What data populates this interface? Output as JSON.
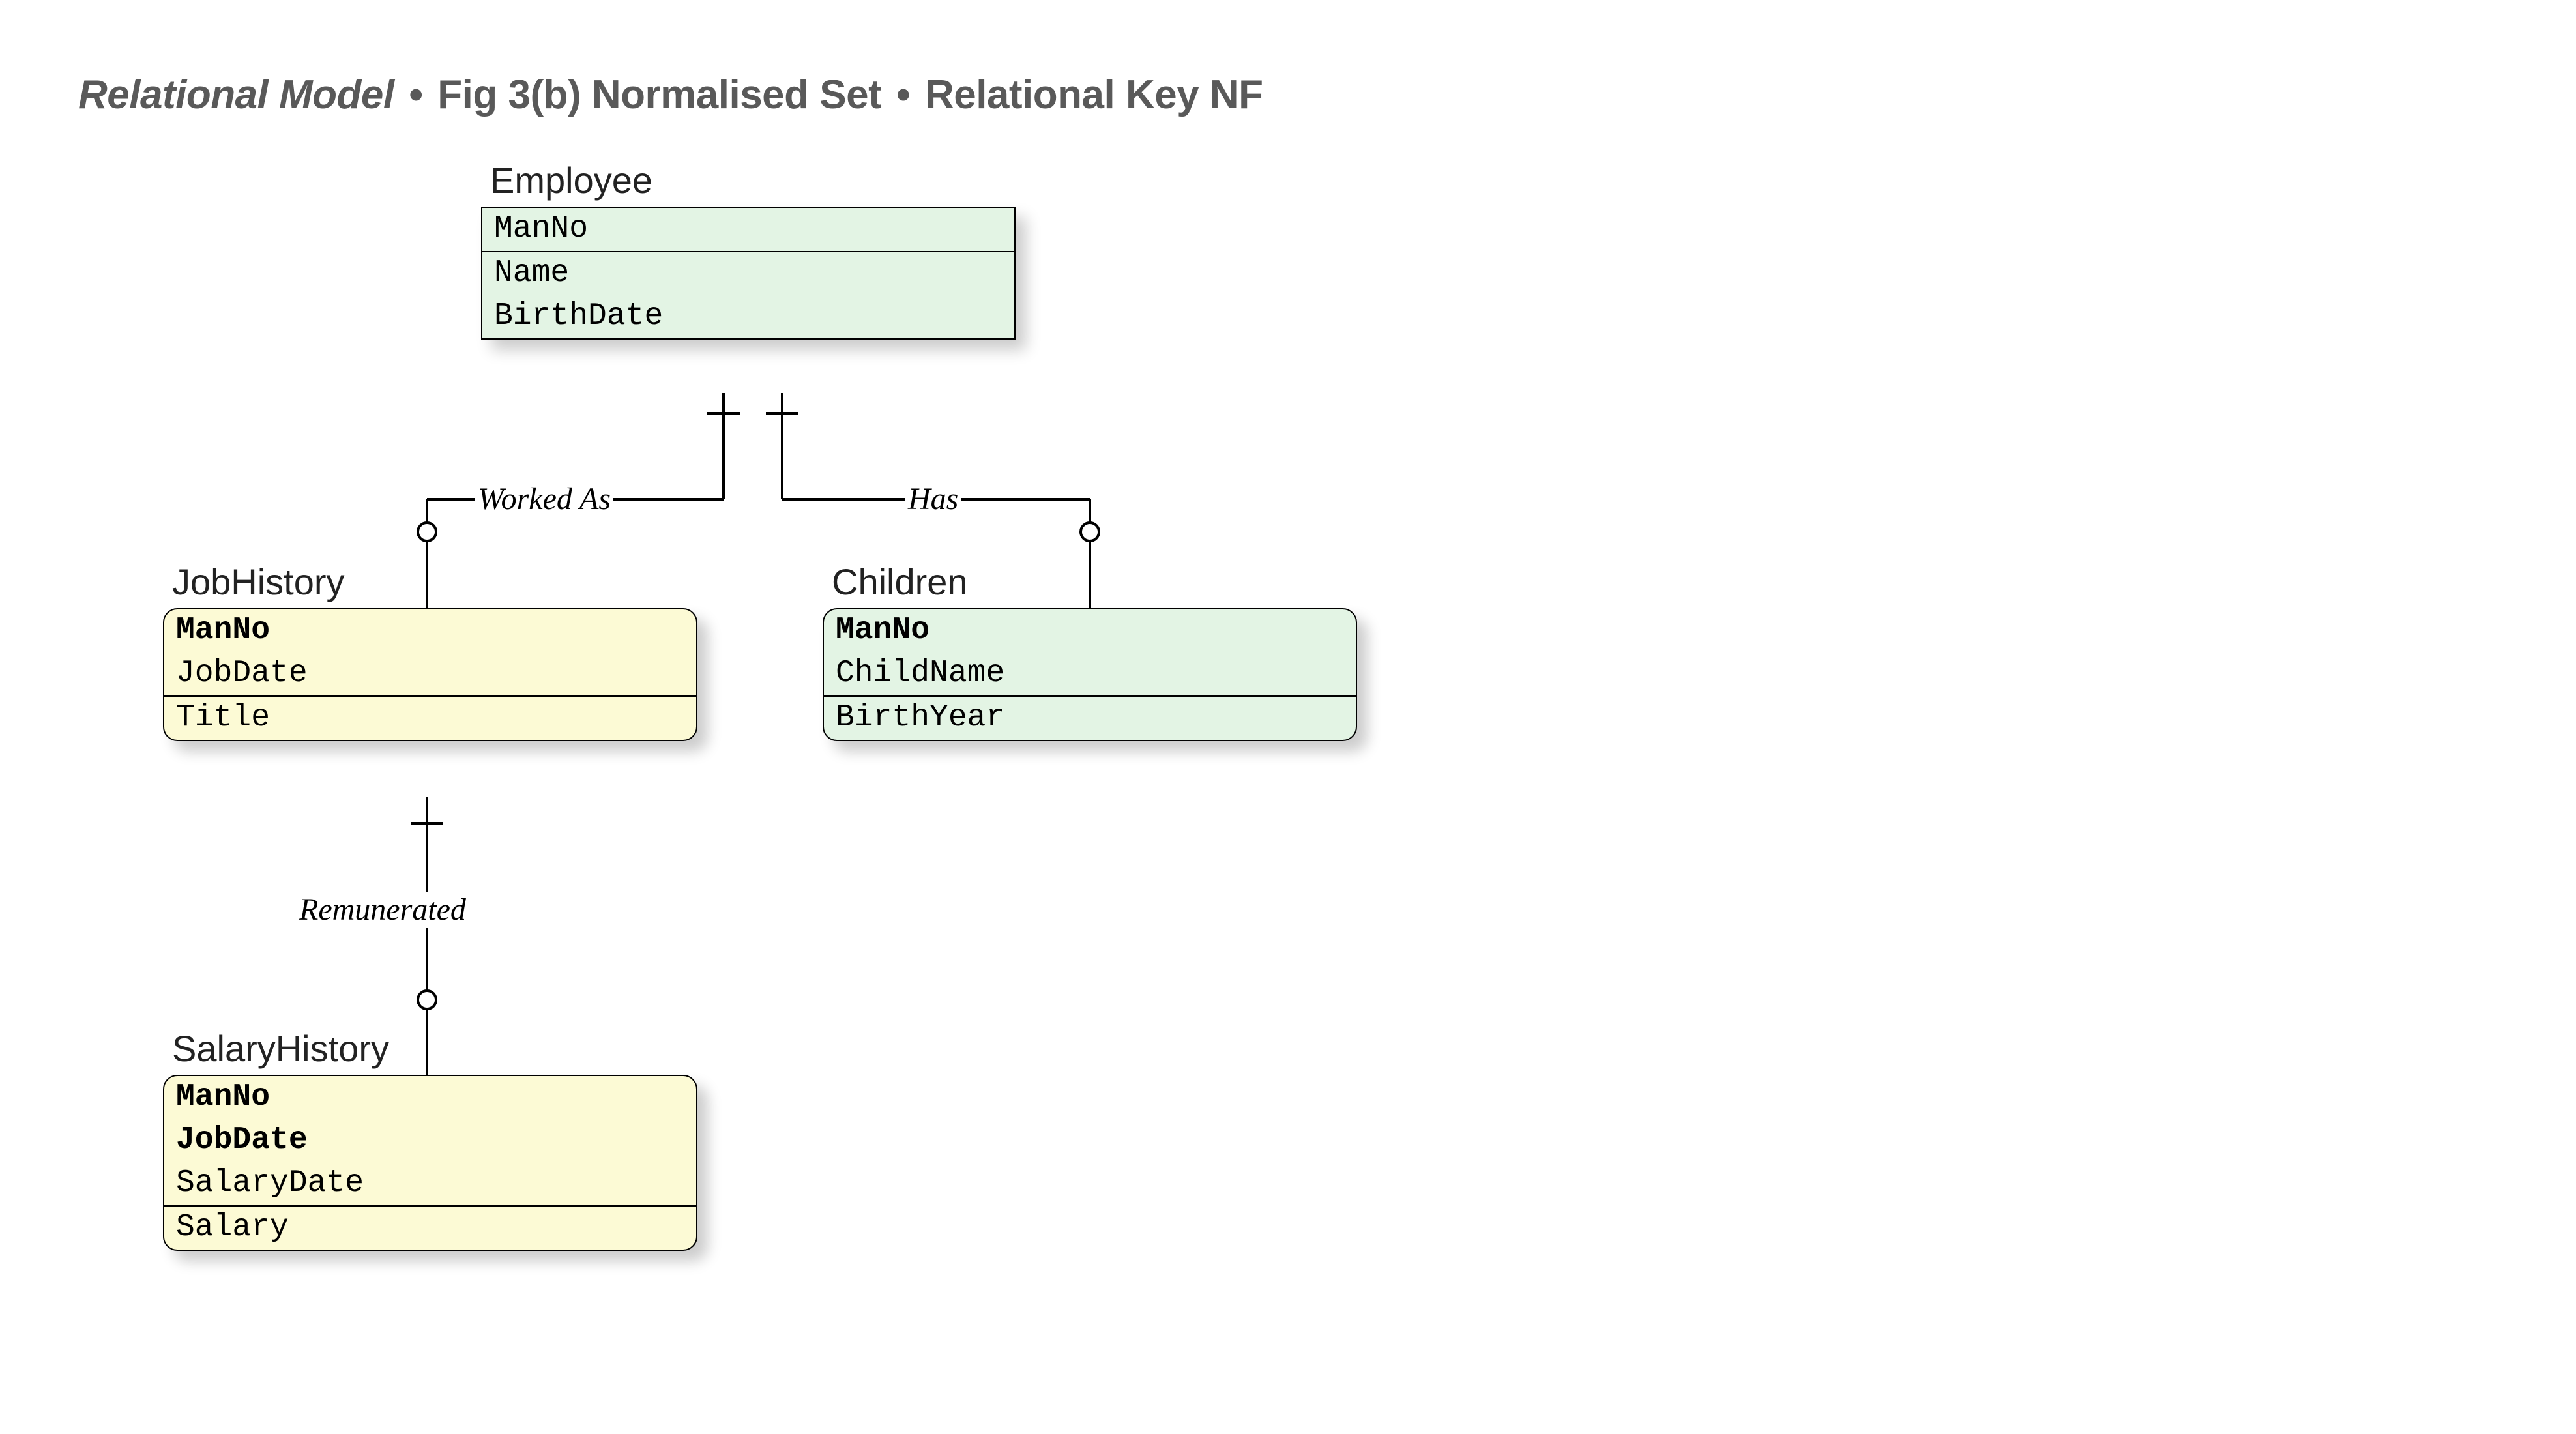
{
  "heading": {
    "segment1": "Relational Model",
    "segment2": "Fig 3(b) Normalised Set",
    "segment3": "Relational Key NF",
    "dot": "•"
  },
  "entities": {
    "employee": {
      "title": "Employee",
      "attrs": [
        "ManNo",
        "Name",
        "BirthDate"
      ],
      "key_divider_after": 0,
      "bold_rows": []
    },
    "jobhistory": {
      "title": "JobHistory",
      "attrs": [
        "ManNo",
        "JobDate",
        "Title"
      ],
      "key_divider_after": 1,
      "bold_rows": [
        0
      ]
    },
    "children": {
      "title": "Children",
      "attrs": [
        "ManNo",
        "ChildName",
        "BirthYear"
      ],
      "key_divider_after": 1,
      "bold_rows": [
        0
      ]
    },
    "salaryhistory": {
      "title": "SalaryHistory",
      "attrs": [
        "ManNo",
        "JobDate",
        "SalaryDate",
        "Salary"
      ],
      "key_divider_after": 2,
      "bold_rows": [
        0,
        1
      ]
    }
  },
  "relationships": {
    "worked_as": "Worked As",
    "has": "Has",
    "remunerated": "Remunerated"
  }
}
